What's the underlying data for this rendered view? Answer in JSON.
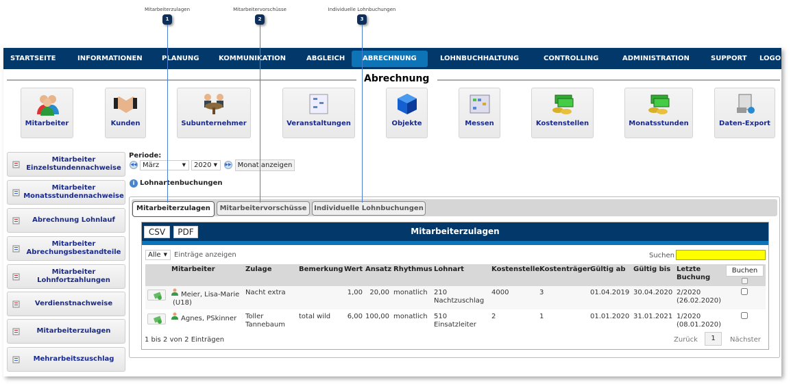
{
  "annotations": [
    {
      "num": "1",
      "label": "Mitarbeiterzulagen"
    },
    {
      "num": "2",
      "label": "Mitarbeitervorschüsse"
    },
    {
      "num": "3",
      "label": "Individuelle Lohnbuchungen"
    }
  ],
  "nav": {
    "items": [
      "STARTSEITE",
      "INFORMATIONEN",
      "PLANUNG",
      "KOMMUNIKATION",
      "ABGLEICH",
      "ABRECHNUNG",
      "LOHNBUCHHALTUNG",
      "CONTROLLING",
      "ADMINISTRATION",
      "SUPPORT",
      "LOGOUT"
    ],
    "active": "ABRECHNUNG"
  },
  "page_title": "Abrechnung",
  "tiles": [
    {
      "label": "Mitarbeiter",
      "icon": "users-icon"
    },
    {
      "label": "Kunden",
      "icon": "handshake-icon"
    },
    {
      "label": "Subunternehmer",
      "icon": "meeting-icon"
    },
    {
      "label": "Veranstaltungen",
      "icon": "diagram-board-icon"
    },
    {
      "label": "Objekte",
      "icon": "cube-icon"
    },
    {
      "label": "Messen",
      "icon": "calendar-grid-icon"
    },
    {
      "label": "Kostenstellen",
      "icon": "money-coins-icon"
    },
    {
      "label": "Monatsstunden",
      "icon": "money-coins-icon"
    },
    {
      "label": "Daten-Export",
      "icon": "database-export-icon"
    }
  ],
  "sidebar": [
    "Mitarbeiter Einzelstundennachweise",
    "Mitarbeiter Monatsstundennachweise",
    "Abrechnung Lohnlauf",
    "Mitarbeiter Abrechungsbestandteile",
    "Mitarbeiter Lohnfortzahlungen",
    "Verdienstnachweise",
    "Mitarbeiterzulagen",
    "Mehrarbeitszuschlag"
  ],
  "period": {
    "label": "Periode:",
    "month": "März",
    "year": "2020",
    "show_button": "Monat anzeigen"
  },
  "section_title": "Lohnartenbuchungen",
  "tabs": [
    "Mitarbeiterzulagen",
    "Mitarbeitervorschüsse",
    "Individuelle Lohnbuchungen"
  ],
  "active_tab": "Mitarbeiterzulagen",
  "table_box": {
    "title": "Mitarbeiterzulagen",
    "csv": "CSV",
    "pdf": "PDF",
    "length_value": "Alle",
    "length_label": "Einträge anzeigen",
    "search_label": "Suchen",
    "search_value": "",
    "search_color": "#ffff00",
    "columns": [
      "Mitarbeiter",
      "Zulage",
      "Bemerkung",
      "Wert",
      "Ansatz",
      "Rhythmus",
      "Lohnart",
      "Kostenstelle",
      "Kostenträger",
      "Gültig ab",
      "Gültig bis",
      "Letzte Buchung"
    ],
    "book_button": "Buchen",
    "rows": [
      {
        "mitarbeiter": "Meier, Lisa-Marie (U18)",
        "zulage": "Nacht extra",
        "bemerkung": "",
        "wert": "1,00",
        "ansatz": "20,00",
        "rhythmus": "monatlich",
        "lohnart": "210 Nachtzuschlag",
        "kostenstelle": "4000",
        "kostentraeger": "3",
        "gueltig_ab": "01.04.2019",
        "gueltig_bis": "30.04.2020",
        "letzte_buchung": "2/2020 (26.02.2020)",
        "checked": false
      },
      {
        "mitarbeiter": "Agnes, PSkinner",
        "zulage": "Toller Tannebaum",
        "bemerkung": "total wild",
        "wert": "6,00",
        "ansatz": "100,00",
        "rhythmus": "monatlich",
        "lohnart": "510 Einsatzleiter",
        "kostenstelle": "2",
        "kostentraeger": "1",
        "gueltig_ab": "01.01.2020",
        "gueltig_bis": "31.01.2021",
        "letzte_buchung": "1/2020 (08.01.2020)",
        "checked": false
      }
    ],
    "info": "1 bis 2 von 2 Einträgen",
    "pagination": {
      "prev": "Zurück",
      "page": "1",
      "next": "Nächster"
    }
  }
}
